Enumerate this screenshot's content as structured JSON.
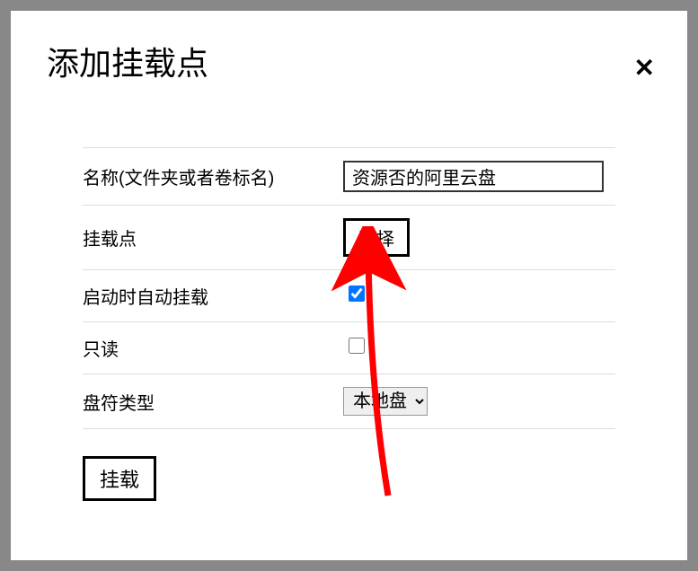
{
  "dialog": {
    "title": "添加挂载点",
    "close_symbol": "✕"
  },
  "form": {
    "name": {
      "label": "名称(文件夹或者卷标名)",
      "value": "资源否的阿里云盘"
    },
    "mount_point": {
      "label": "挂载点",
      "button": "选择"
    },
    "auto_mount": {
      "label": "启动时自动挂载",
      "checked": true
    },
    "readonly": {
      "label": "只读",
      "checked": false
    },
    "disk_type": {
      "label": "盘符类型",
      "selected": "本地盘",
      "options": [
        "本地盘"
      ]
    },
    "submit": "挂载"
  },
  "annotation": {
    "arrow_color": "#ff0000"
  }
}
